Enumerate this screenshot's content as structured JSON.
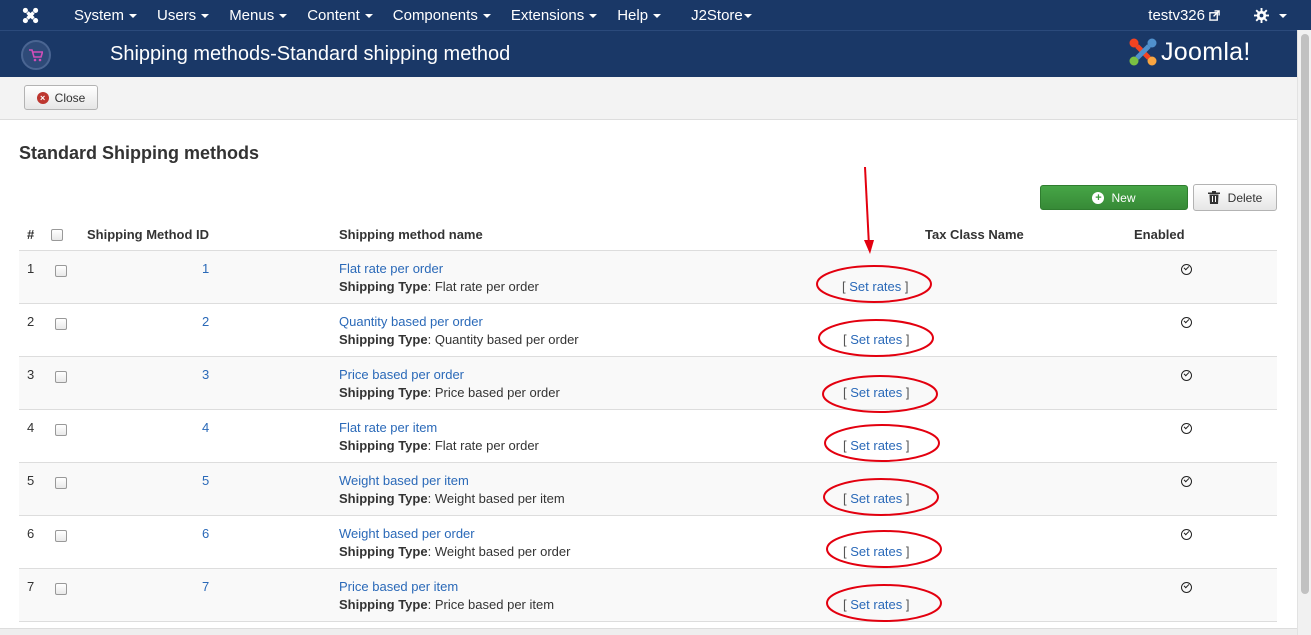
{
  "navbar": {
    "menus": [
      "System",
      "Users",
      "Menus",
      "Content",
      "Components",
      "Extensions",
      "Help",
      "J2Store"
    ],
    "user": "testv326"
  },
  "header": {
    "title": "Shipping methods-Standard shipping method",
    "brand": "Joomla!"
  },
  "toolbar": {
    "close_label": "Close"
  },
  "page": {
    "heading": "Standard Shipping methods",
    "new_label": "New",
    "delete_label": "Delete"
  },
  "table": {
    "columns": {
      "num": "#",
      "id": "Shipping Method ID",
      "name": "Shipping method name",
      "tax": "Tax Class Name",
      "enabled": "Enabled"
    },
    "shipping_type_label": "Shipping Type",
    "set_rates_label": "Set rates",
    "rows": [
      {
        "num": "1",
        "id": "1",
        "name": "Flat rate per order",
        "type": "Flat rate per order",
        "enabled": true
      },
      {
        "num": "2",
        "id": "2",
        "name": "Quantity based per order",
        "type": "Quantity based per order",
        "enabled": true
      },
      {
        "num": "3",
        "id": "3",
        "name": "Price based per order",
        "type": "Price based per order",
        "enabled": true
      },
      {
        "num": "4",
        "id": "4",
        "name": "Flat rate per item",
        "type": "Flat rate per order",
        "enabled": true
      },
      {
        "num": "5",
        "id": "5",
        "name": "Weight based per item",
        "type": "Weight based per item",
        "enabled": true
      },
      {
        "num": "6",
        "id": "6",
        "name": "Weight based per order",
        "type": "Weight based per order",
        "enabled": true
      },
      {
        "num": "7",
        "id": "7",
        "name": "Price based per item",
        "type": "Price based per item",
        "enabled": true
      }
    ]
  },
  "colors": {
    "navbar": "#1a3867",
    "link": "#2a69b8",
    "new_button": "#46a546",
    "annotation": "#e3000f"
  }
}
